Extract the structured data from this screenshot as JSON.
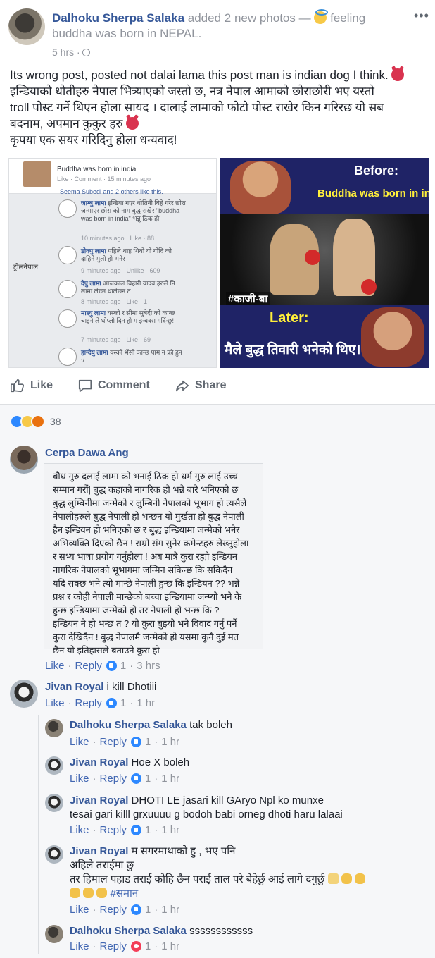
{
  "post": {
    "author": "Dalhoku Sherpa Salaka",
    "action": "added 2 new photos —",
    "feeling": "feeling",
    "feeling_line2": "buddha was born in NEPAL.",
    "time": "5 hrs ·",
    "more": "•••",
    "text_lines": [
      "Its wrong post, posted not dalai lama this post man is indian dog I think.",
      "इन्डियाको धोतीहरु नेपाल भित्र्याएको जस्तो छ, नत्र नेपाल आमाको छोराछोरी भए यस्तो",
      "troll पोस्ट गर्ने थिएन होला सायद । दालाई लामाको फोटो पोस्ट राखेर किन गरिरछ यो सब",
      "बदनाम, अपमान कुकुर हरु",
      "कृपया एक सयर गरिदिनु होला धन्यवाद!"
    ]
  },
  "photo_left": {
    "header": "Buddha was born in india",
    "header_meta": "Like · Comment · 15 minutes ago",
    "likes": "Seema Subedi and 2 others like this.",
    "watermark": "ट्रोलनेपाल",
    "comments": [
      {
        "name": "जाम्बु लामा",
        "text": "इन्डिया गएर धोतिनी बिहे गरेर छोरा जन्माएर छोरा को नाम बुद्ध राखेर \"buddha was born in india\" भन्नु ठिक हो",
        "meta": "10 minutes ago · Like · 88"
      },
      {
        "name": "डोक्पु लामा",
        "text": "पहिले थाह थियो यो गोदि को दाहिने मुलो हो भनेर",
        "meta": "9 minutes ago · Unlike · 609"
      },
      {
        "name": "देपु लामा",
        "text": "आजकाल बिहारी यादव हरुले नि लामा लेख्न थालेछन त",
        "meta": "8 minutes ago · Like · 1"
      },
      {
        "name": "मास्यु लामा",
        "text": "यस्को र सीमा सुबेदी को कान्छ चाइने ले थोप्लो दिन हो म इन्बक्स गर्दिन्छु!",
        "meta": "7 minutes ago · Like · 69"
      },
      {
        "name": "हान्देयु लामा",
        "text": "यस्को भैंसी कान्छ पाम न फ्रो हुन :/",
        "meta": ""
      }
    ]
  },
  "photo_right": {
    "before_label": "Before:",
    "before_text": "Buddha was born in india",
    "hashtag": "#काजी-बा",
    "later_label": "Later:",
    "later_text": "मैले बुद्ध तिवारी भनेको थिए।"
  },
  "actions": {
    "like": "Like",
    "comment": "Comment",
    "share": "Share"
  },
  "reactions": {
    "count": "38"
  },
  "comments": [
    {
      "name": "Cerpa Dawa Ang",
      "text_lines": [
        "बौध गुरु दलाई लामा को भनाई ठिक हो धर्म गुरु लाई उच्च",
        "सम्मान गरौं| बुद्ध कहाको नागरिक हो भन्ने बारे भनिएको छ",
        "बुद्ध लुम्बिनीमा जन्मेको र लुम्बिनी नेपालको भूभाग हो त्यसैले",
        "नेपालीहरुले बुद्ध नेपाली हो भन्छन यो मुर्खता हो बुद्ध नेपाली",
        "हैन इन्डियन हो भनिएको छ र बुद्ध इन्डियामा जन्मेको भनेर",
        "अभिव्यक्ति दिएको छैन ! राम्रो संग सुनेर कमेन्टहरु लेख्नुहोला",
        "र सभ्य भाषा प्रयोग गर्नुहोला ! अब मात्रै कुरा रह्यो इन्डियन",
        "नागरिक नेपालको भूभागमा जन्मिन सकिन्छ कि सकिदैन",
        "यदि सक्छ भने त्यो मान्छे नेपाली हुन्छ कि इन्डियन ?? भन्ने",
        "प्रश्न र कोही नेपाली मान्छेको बच्चा इन्डियामा जन्म्यो भने के",
        "हुन्छ इन्डियामा जन्मेको हो तर नेपाली हो भन्छ कि ?",
        "इन्डियन नै हो भन्छ त ? यो कुरा बुझ्यो भने विवाद गर्नु पर्ने",
        "कुरा देखिदैन ! बुद्ध नेपालमै जन्मेको हो यसमा कुनै दुई मत",
        "छैन यो इतिहासले बताउने कुरा हो"
      ],
      "like": "Like",
      "reply": "Reply",
      "count": "1",
      "time": "3 hrs"
    },
    {
      "name": "Jivan Royal",
      "text": "i kill Dhotiii",
      "like": "Like",
      "reply": "Reply",
      "count": "1",
      "time": "1 hr"
    }
  ],
  "replies": [
    {
      "name": "Dalhoku Sherpa Salaka",
      "text": "tak boleh",
      "like": "Like",
      "reply": "Reply",
      "count": "1",
      "time": "1 hr"
    },
    {
      "name": "Jivan Royal",
      "text": "Hoe X boleh",
      "like": "Like",
      "reply": "Reply",
      "count": "1",
      "time": "1 hr"
    },
    {
      "name": "Jivan Royal",
      "text": "DHOTI LE jasari kill GAryo Npl ko munxe",
      "text2": "tesai gari killl grxuuuu g bodoh babi orneg dhoti haru lalaai",
      "like": "Like",
      "reply": "Reply",
      "count": "1",
      "time": "1 hr"
    },
    {
      "name": "Jivan Royal",
      "text": "म सगरमाथाको हु , भए पनि",
      "text2": "अहिले तराईमा छु",
      "text3": "तर हिमाल पहाड तराई कोहि छैन पराई ताल परे बेहेर्छु आई लागे दगुर्छु",
      "text4": "#समान",
      "like": "Like",
      "reply": "Reply",
      "count": "1",
      "time": "1 hr"
    },
    {
      "name": "Dalhoku Sherpa Salaka",
      "text": "ssssssssssss",
      "like": "Like",
      "reply": "Reply",
      "count": "1",
      "time": "1 hr"
    }
  ]
}
